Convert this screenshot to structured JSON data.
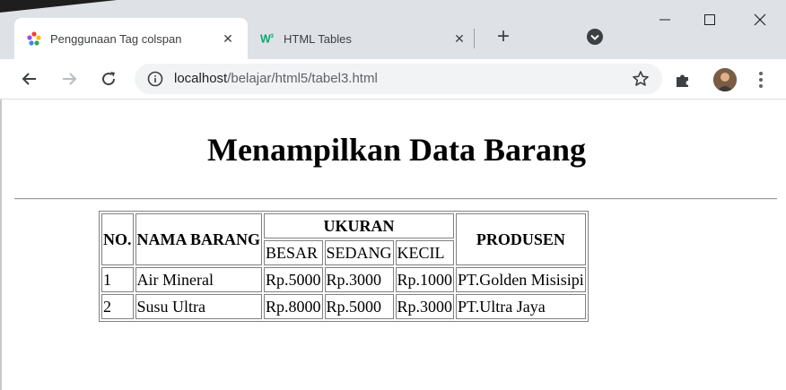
{
  "browser": {
    "tabs": [
      {
        "title": "Penggunaan Tag colspan",
        "active": true,
        "favicon": "colorful-flower-icon"
      },
      {
        "title": "HTML Tables",
        "active": false,
        "favicon": "w3schools-icon"
      }
    ],
    "url_host": "localhost",
    "url_path": "/belajar/html5/tabel3.html"
  },
  "page": {
    "title": "Menampilkan Data Barang",
    "table": {
      "headers": {
        "no": "NO.",
        "nama": "NAMA BARANG",
        "ukuran": "UKURAN",
        "produsen": "PRODUSEN",
        "sizes": [
          "BESAR",
          "SEDANG",
          "KECIL"
        ]
      },
      "rows": [
        [
          "1",
          "Air Mineral",
          "Rp.5000",
          "Rp.3000",
          "Rp.1000",
          "PT.Golden Misisipi"
        ],
        [
          "2",
          "Susu Ultra",
          "Rp.8000",
          "Rp.5000",
          "Rp.3000",
          "PT.Ultra Jaya"
        ]
      ]
    }
  },
  "colors": {
    "tab_strip": "#dee1e6",
    "omnibox": "#f1f3f4",
    "table_border": "#808080"
  }
}
